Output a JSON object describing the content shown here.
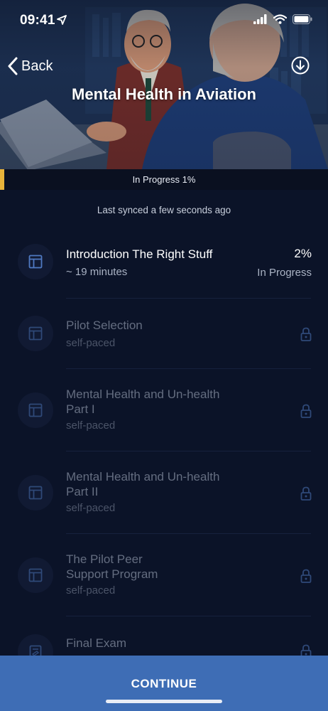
{
  "status": {
    "time": "09:41",
    "icons": [
      "location-arrow-icon",
      "signal-icon",
      "wifi-icon",
      "battery-icon"
    ]
  },
  "header": {
    "back_label": "Back",
    "title": "Mental Health in Aviation",
    "download_icon": "download-icon"
  },
  "progress": {
    "label": "In Progress 1%",
    "value": 0.01,
    "color": "#e8b33a"
  },
  "sync": {
    "text": "Last synced a few seconds ago"
  },
  "modules": [
    {
      "title_line1": "Introduction The Right Stuff",
      "title_line2": "",
      "subtitle": "~ 19 minutes",
      "percent": "2%",
      "state": "In Progress",
      "icon": "module-icon",
      "locked": false
    },
    {
      "title_line1": "Pilot Selection",
      "title_line2": "",
      "subtitle": "self-paced",
      "icon": "module-icon",
      "locked": true
    },
    {
      "title_line1": "Mental Health and Un-health",
      "title_line2": "Part I",
      "subtitle": "self-paced",
      "icon": "module-icon",
      "locked": true
    },
    {
      "title_line1": "Mental Health and Un-health",
      "title_line2": "Part II",
      "subtitle": "self-paced",
      "icon": "module-icon",
      "locked": true
    },
    {
      "title_line1": "The Pilot Peer",
      "title_line2": "Support Program",
      "subtitle": "self-paced",
      "icon": "module-icon",
      "locked": true
    },
    {
      "title_line1": "Final Exam",
      "title_line2": "",
      "subtitle": "",
      "icon": "exam-icon",
      "locked": true
    }
  ],
  "footer": {
    "continue_label": "CONTINUE"
  },
  "colors": {
    "background": "#0b1328",
    "accent": "#3e6db5",
    "progress": "#e8b33a",
    "icon_blue": "#3a5a9a"
  }
}
